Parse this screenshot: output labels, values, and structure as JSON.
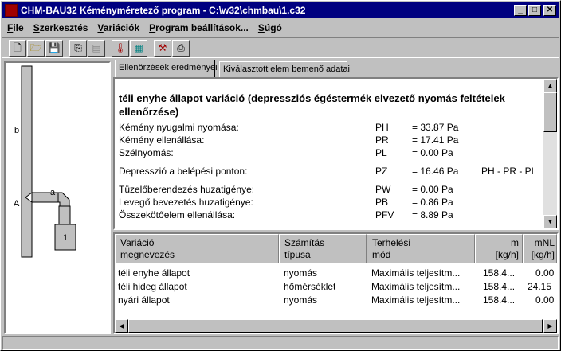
{
  "window": {
    "title": "CHM-BAU32 Kéményméretező program - C:\\w32\\chmbau\\1.c32",
    "min": "_",
    "max": "□",
    "close": "✕"
  },
  "menu": [
    "File",
    "Szerkesztés",
    "Variációk",
    "Program beállítások...",
    "Súgó"
  ],
  "tabs": [
    "Ellenőrzések eredményei",
    "Kiválasztott elem bemenő adatai"
  ],
  "diagram": {
    "label_b": "b",
    "label_a": "a",
    "label_A": "A",
    "box": "1"
  },
  "results": {
    "heading": "téli enyhe állapot variáció (depressziós égéstermék elvezető nyomás feltételek ellenőrzése)",
    "rows": [
      {
        "label": "Kémény nyugalmi nyomása:",
        "sym": "PH",
        "val": "= 33.87 Pa",
        "formula": ""
      },
      {
        "label": "Kémény ellenállása:",
        "sym": "PR",
        "val": "= 17.41 Pa",
        "formula": ""
      },
      {
        "label": "Szélnyomás:",
        "sym": "PL",
        "val": "= 0.00 Pa",
        "formula": ""
      },
      {
        "label": "Depresszió a belépési ponton:",
        "sym": "PZ",
        "val": "= 16.46 Pa",
        "formula": "PH - PR - PL"
      },
      {
        "label": "Tüzelőberendezés huzatigénye:",
        "sym": "PW",
        "val": "= 0.00 Pa",
        "formula": ""
      },
      {
        "label": "Levegő bevezetés huzatigénye:",
        "sym": "PB",
        "val": "= 0.86 Pa",
        "formula": ""
      },
      {
        "label": "Összekötőelem ellenállása:",
        "sym": "PFV",
        "val": "= 8.89 Pa",
        "formula": ""
      }
    ]
  },
  "table": {
    "headers": [
      {
        "l1": "Variáció",
        "l2": "megnevezés"
      },
      {
        "l1": "Számítás",
        "l2": "típusa"
      },
      {
        "l1": "Terhelési",
        "l2": "mód"
      },
      {
        "l1": "m",
        "l2": "[kg/h]"
      },
      {
        "l1": "mNL",
        "l2": "[kg/h]"
      }
    ],
    "rows": [
      {
        "name": "téli enyhe állapot",
        "calc": "nyomás",
        "mode": "Maximális teljesítm...",
        "m": "158.4...",
        "mnl": "0.00"
      },
      {
        "name": "téli hideg állapot",
        "calc": "hőmérséklet",
        "mode": "Maximális teljesítm...",
        "m": "158.4...",
        "mnl": "24.15"
      },
      {
        "name": "nyári állapot",
        "calc": "nyomás",
        "mode": "Maximális teljesítm...",
        "m": "158.4...",
        "mnl": "0.00"
      }
    ]
  },
  "colors": {
    "titlebar": "#000080",
    "face": "#c0c0c0"
  }
}
